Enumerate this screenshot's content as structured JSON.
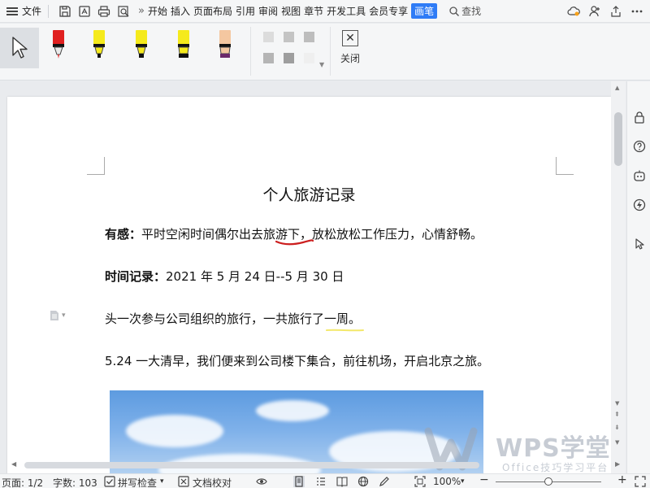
{
  "menubar": {
    "file_label": "文件",
    "more_glyph": "»",
    "tabs": [
      {
        "label": "开始",
        "active": false
      },
      {
        "label": "插入",
        "active": false
      },
      {
        "label": "页面布局",
        "active": false
      },
      {
        "label": "引用",
        "active": false
      },
      {
        "label": "审阅",
        "active": false
      },
      {
        "label": "视图",
        "active": false
      },
      {
        "label": "章节",
        "active": false
      },
      {
        "label": "开发工具",
        "active": false
      },
      {
        "label": "会员专享",
        "active": false
      },
      {
        "label": "画笔",
        "active": true
      }
    ],
    "search_label": "查找",
    "quick_access_icons": [
      "save-icon",
      "export-pdf-icon",
      "print-icon",
      "print-preview-icon"
    ],
    "right_icons": [
      "cloud-sync-icon",
      "add-user-icon",
      "share-icon",
      "more-options-icon"
    ]
  },
  "pen_ribbon": {
    "select_tool_icon": "arrow-cursor-icon",
    "pens": [
      {
        "name": "red-pen",
        "color": "#e02020"
      },
      {
        "name": "yellow-highlighter-1",
        "color": "#f5ea1c"
      },
      {
        "name": "yellow-highlighter-2",
        "color": "#f5ea1c"
      },
      {
        "name": "yellow-highlighter-3",
        "color": "#f5ea1c"
      },
      {
        "name": "peach-highlighter",
        "color": "#f4c7a0"
      }
    ],
    "swatches": [
      "#dcdcdc",
      "#c4c4c4",
      "#bdbdbd",
      "#b5b5b5",
      "#9e9e9e",
      "#efefef"
    ],
    "close_label": "关闭",
    "close_glyph": "✕"
  },
  "document": {
    "title": "个人旅游记录",
    "p1_bold": "有感：",
    "p1_text": "平时空闲时间偶尔出去旅游下，放松放松工作压力，心情舒畅。",
    "p2_bold": "时间记录：",
    "p2_text": "2021 年 5 月 24 日--5 月 30 日",
    "p3_text": "头一次参与公司组织的旅行，一共旅行了一周。",
    "p4_text": "5.24 一大清早，我们便来到公司楼下集合，前往机场，开启北京之旅。",
    "ink_red_color": "#cc1f1f",
    "ink_yellow_color": "#f3e86a"
  },
  "watermark": {
    "text": "WPS学堂",
    "subtext": "Office技巧学习平台"
  },
  "statusbar": {
    "page": "页面: 1/2",
    "word_count": "字数: 103",
    "spell_check": "拼写检查",
    "doc_proof": "文档校对",
    "zoom": "100%",
    "zoom_fraction": 0.5
  }
}
